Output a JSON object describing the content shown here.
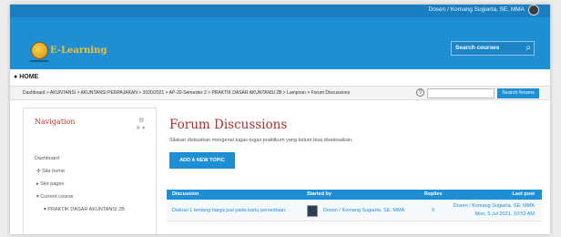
{
  "header": {
    "user_label": "Dosen / Komang Sugiarta, SE, MMA",
    "logo_text": "E-Learning",
    "search_label": "Search courses",
    "search_icon": "search-icon"
  },
  "home_label": "HOME",
  "breadcrumb": "Dashboard  >  AKUNTANSI  >  AKUNTANSI PERPAJAKAN  >  2020/2021  >  AP-20-Semester 2  >  PRAKTIK DASAR AKUNTANSI 2B  >  Lampiran  >  Forum Discussions",
  "forum_search": {
    "placeholder": "",
    "button": "Search forums",
    "help_icon": "?"
  },
  "navigation": {
    "title": "Navigation",
    "items": [
      "Dashboard",
      "Site home",
      "Site pages",
      "Current course",
      "PRAKTIK DASAR AKUNTANSI 2B"
    ]
  },
  "main": {
    "title": "Forum Discussions",
    "description": "Silakan diskusikan mengenai tugas-tugas praktikum yang belum bisa diselesaikan.",
    "add_topic": "ADD A NEW TOPIC"
  },
  "table": {
    "headers": [
      "Discussion",
      "Started by",
      "Replies",
      "Last post"
    ],
    "rows": [
      {
        "discussion": "Diskusi 1 tentang harga jual pada kartu persediaan",
        "started_by": "Dosen / Komang Sugiarta, SE, MMA",
        "replies": "0",
        "last_post_by": "Dosen / Komang Sugiarta, SE, MMA",
        "last_post_date": "Mon, 5 Jul 2021, 10:53 AM"
      }
    ]
  },
  "colors": {
    "brand_blue": "#1e8fd5",
    "title_red": "#a3332b"
  }
}
